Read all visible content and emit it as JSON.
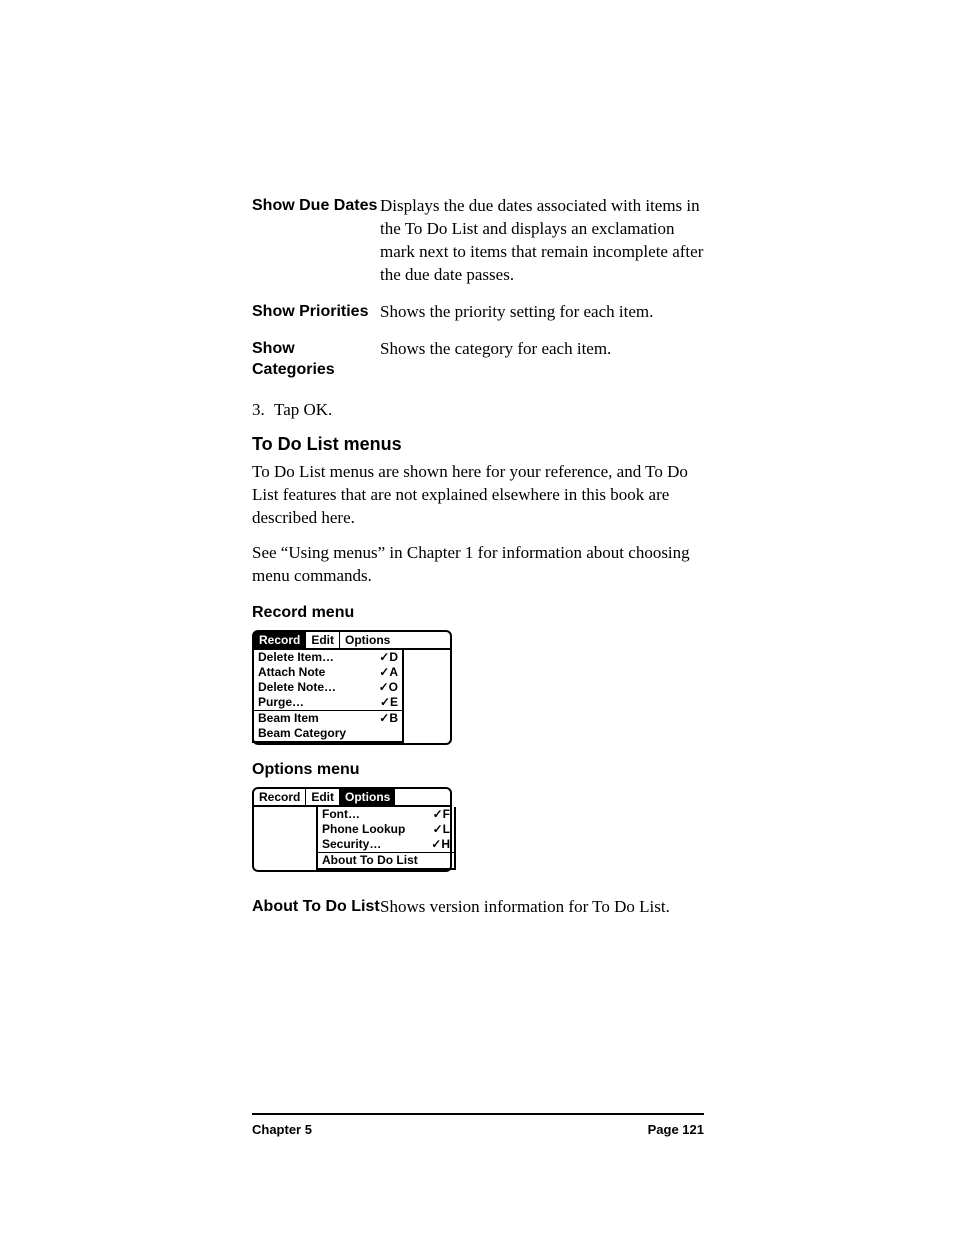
{
  "defs": {
    "showDueDates": {
      "term": "Show Due Dates",
      "desc": "Displays the due dates associated with items in the To Do List and displays an exclamation mark next to items that remain incomplete after the due date passes."
    },
    "showPriorities": {
      "term": "Show Priorities",
      "desc": "Shows the priority setting for each item."
    },
    "showCategories": {
      "term": "Show Categories",
      "desc": "Shows the category for each item."
    }
  },
  "step3": {
    "num": "3.",
    "text": "Tap OK."
  },
  "headings": {
    "todolistmenus": "To Do List menus",
    "recordmenu": "Record menu",
    "optionsmenu": "Options menu"
  },
  "paras": {
    "p1": "To Do List menus are shown here for your reference, and To Do List features that are not explained elsewhere in this book are described here.",
    "p2": "See “Using menus” in Chapter 1 for information about choosing menu commands."
  },
  "menubar": {
    "record": "Record",
    "edit": "Edit",
    "options": "Options"
  },
  "recordMenu": {
    "items": [
      {
        "label": "Delete Item…",
        "shortcut": "✓D"
      },
      {
        "label": "Attach Note",
        "shortcut": "✓A"
      },
      {
        "label": "Delete Note…",
        "shortcut": "✓O"
      },
      {
        "label": "Purge…",
        "shortcut": "✓E"
      },
      {
        "label": "Beam Item",
        "shortcut": "✓B"
      },
      {
        "label": "Beam Category",
        "shortcut": ""
      }
    ]
  },
  "optionsMenu": {
    "items": [
      {
        "label": "Font…",
        "shortcut": "✓F"
      },
      {
        "label": "Phone Lookup",
        "shortcut": "✓L"
      },
      {
        "label": "Security…",
        "shortcut": "✓H"
      },
      {
        "label": "About To Do List",
        "shortcut": ""
      }
    ]
  },
  "aboutRow": {
    "term": "About To Do List",
    "desc": "Shows version information for To Do List."
  },
  "footer": {
    "left": "Chapter 5",
    "right": "Page 121"
  }
}
